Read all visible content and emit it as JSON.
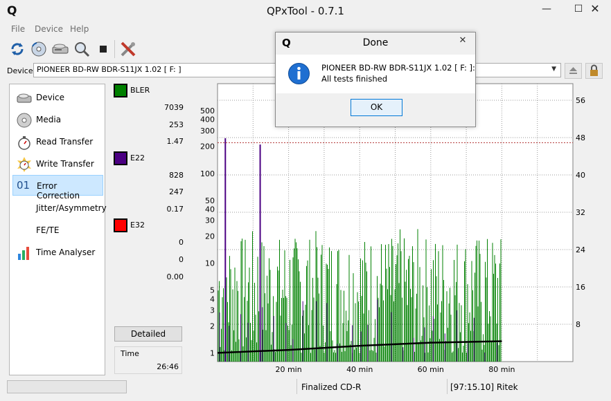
{
  "window": {
    "title": "QPxTool - 0.7.1",
    "logo": "Q",
    "controls": [
      "minimize-icon",
      "maximize-icon",
      "close-icon"
    ]
  },
  "menu": [
    "File",
    "Device",
    "Help"
  ],
  "toolbar": [
    "refresh-icon",
    "media-scan-icon",
    "device-info-icon",
    "search-disc-icon",
    "stop-icon",
    "tools-icon"
  ],
  "device": {
    "label": "Device:",
    "selected": "PIONEER  BD-RW  BDR-S11JX 1.02 [ F: ]"
  },
  "nav": [
    {
      "label": "Device",
      "icon": "drive-icon",
      "selected": false
    },
    {
      "label": "Media",
      "icon": "disc-icon",
      "selected": false
    },
    {
      "label": "Read Transfer",
      "icon": "stopwatch-icon",
      "selected": false
    },
    {
      "label": "Write Transfer",
      "icon": "stopwatch-burst-icon",
      "selected": false
    },
    {
      "label": "Error Correction",
      "icon": "binary-01-icon",
      "icon_text": "01",
      "selected": true
    },
    {
      "label": "Jitter/Asymmetry",
      "icon": "",
      "selected": false
    },
    {
      "label": "FE/TE",
      "icon": "",
      "selected": false
    },
    {
      "label": "Time Analyser",
      "icon": "bar-chart-icon",
      "selected": false
    }
  ],
  "stats": {
    "bler": {
      "name": "BLER",
      "color": "#008000",
      "total": "7039",
      "max": "253",
      "avg": "1.47"
    },
    "e22": {
      "name": "E22",
      "color": "#4b0082",
      "total": "828",
      "max": "247",
      "avg": "0.17"
    },
    "e32": {
      "name": "E32",
      "color": "#ff0000",
      "total": "0",
      "max": "0",
      "avg": "0.00"
    },
    "detailed_label": "Detailed",
    "time_label": "Time",
    "time_value": "26:46"
  },
  "chart_data": {
    "type": "bar",
    "y_left_scale": "log",
    "y_left_ticks": [
      1,
      2,
      3,
      4,
      5,
      10,
      20,
      30,
      40,
      50,
      100,
      200,
      300,
      400,
      500
    ],
    "y_right_ticks": [
      8,
      16,
      24,
      32,
      40,
      48,
      56
    ],
    "x_ticks": [
      "20 min",
      "40 min",
      "60 min",
      "80 min"
    ],
    "x_range_min": [
      0,
      100
    ],
    "data_end_min": 80,
    "threshold_line": 220,
    "series": [
      {
        "name": "BLER",
        "color": "#008000",
        "max": 253,
        "typical_range": [
          1,
          20
        ]
      },
      {
        "name": "E22",
        "color": "#4b0082",
        "max": 247,
        "peaks": [
          {
            "x": 2.2,
            "y": 247
          },
          {
            "x": 12,
            "y": 210
          }
        ]
      },
      {
        "name": "E32",
        "color": "#ff0000",
        "max": 0
      }
    ],
    "speed_curve": {
      "color": "#000000",
      "x": [
        0,
        20,
        40,
        60,
        80
      ],
      "y": [
        1,
        1.08,
        1.2,
        1.3,
        1.35
      ]
    },
    "grid": true
  },
  "status": {
    "media": "Finalized CD-R",
    "manufacturer": "[97:15.10] Ritek"
  },
  "dialog": {
    "title": "Done",
    "logo": "Q",
    "line1": "PIONEER  BD-RW  BDR-S11JX 1.02 [ F: ]:",
    "line2": "All tests finished",
    "ok_label": "OK"
  }
}
